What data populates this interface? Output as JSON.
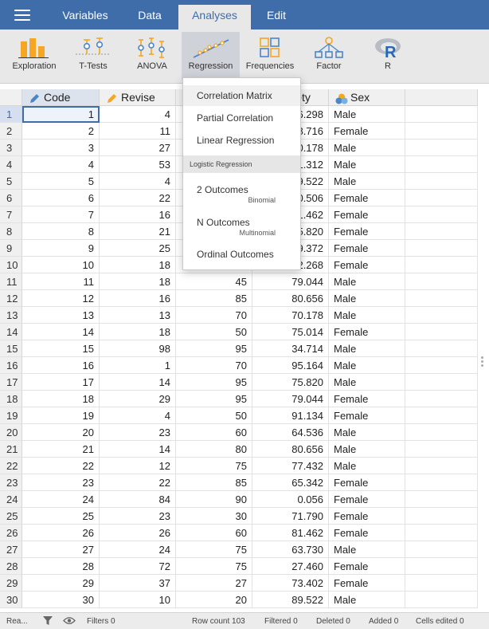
{
  "menubar": {
    "tabs": [
      {
        "label": "Variables"
      },
      {
        "label": "Data"
      },
      {
        "label": "Analyses"
      },
      {
        "label": "Edit"
      }
    ]
  },
  "ribbon": {
    "buttons": [
      {
        "label": "Exploration",
        "icon": "exploration-icon"
      },
      {
        "label": "T-Tests",
        "icon": "ttests-icon"
      },
      {
        "label": "ANOVA",
        "icon": "anova-icon"
      },
      {
        "label": "Regression",
        "icon": "regression-icon"
      },
      {
        "label": "Frequencies",
        "icon": "frequencies-icon"
      },
      {
        "label": "Factor",
        "icon": "factor-icon"
      },
      {
        "label": "R",
        "icon": "r-icon"
      }
    ]
  },
  "grid": {
    "columns": [
      {
        "name": "Code"
      },
      {
        "name": "Revise"
      },
      {
        "name": ""
      },
      {
        "name": "Anxiety"
      },
      {
        "name": "Sex"
      }
    ],
    "rows": [
      {
        "n": "1",
        "code": "1",
        "revise": "4",
        "exam": "",
        "anxiety": "86.298",
        "sex": "Male"
      },
      {
        "n": "2",
        "code": "2",
        "revise": "11",
        "exam": "",
        "anxiety": "88.716",
        "sex": "Female"
      },
      {
        "n": "3",
        "code": "3",
        "revise": "27",
        "exam": "",
        "anxiety": "70.178",
        "sex": "Male"
      },
      {
        "n": "4",
        "code": "4",
        "revise": "53",
        "exam": "",
        "anxiety": "61.312",
        "sex": "Male"
      },
      {
        "n": "5",
        "code": "5",
        "revise": "4",
        "exam": "",
        "anxiety": "89.522",
        "sex": "Male"
      },
      {
        "n": "6",
        "code": "6",
        "revise": "22",
        "exam": "",
        "anxiety": "60.506",
        "sex": "Female"
      },
      {
        "n": "7",
        "code": "7",
        "revise": "16",
        "exam": "",
        "anxiety": "81.462",
        "sex": "Female"
      },
      {
        "n": "8",
        "code": "8",
        "revise": "21",
        "exam": "",
        "anxiety": "75.820",
        "sex": "Female"
      },
      {
        "n": "9",
        "code": "9",
        "revise": "25",
        "exam": "",
        "anxiety": "69.372",
        "sex": "Female"
      },
      {
        "n": "10",
        "code": "10",
        "revise": "18",
        "exam": "",
        "anxiety": "82.268",
        "sex": "Female"
      },
      {
        "n": "11",
        "code": "11",
        "revise": "18",
        "exam": "45",
        "anxiety": "79.044",
        "sex": "Male"
      },
      {
        "n": "12",
        "code": "12",
        "revise": "16",
        "exam": "85",
        "anxiety": "80.656",
        "sex": "Male"
      },
      {
        "n": "13",
        "code": "13",
        "revise": "13",
        "exam": "70",
        "anxiety": "70.178",
        "sex": "Male"
      },
      {
        "n": "14",
        "code": "14",
        "revise": "18",
        "exam": "50",
        "anxiety": "75.014",
        "sex": "Female"
      },
      {
        "n": "15",
        "code": "15",
        "revise": "98",
        "exam": "95",
        "anxiety": "34.714",
        "sex": "Male"
      },
      {
        "n": "16",
        "code": "16",
        "revise": "1",
        "exam": "70",
        "anxiety": "95.164",
        "sex": "Male"
      },
      {
        "n": "17",
        "code": "17",
        "revise": "14",
        "exam": "95",
        "anxiety": "75.820",
        "sex": "Male"
      },
      {
        "n": "18",
        "code": "18",
        "revise": "29",
        "exam": "95",
        "anxiety": "79.044",
        "sex": "Female"
      },
      {
        "n": "19",
        "code": "19",
        "revise": "4",
        "exam": "50",
        "anxiety": "91.134",
        "sex": "Female"
      },
      {
        "n": "20",
        "code": "20",
        "revise": "23",
        "exam": "60",
        "anxiety": "64.536",
        "sex": "Male"
      },
      {
        "n": "21",
        "code": "21",
        "revise": "14",
        "exam": "80",
        "anxiety": "80.656",
        "sex": "Male"
      },
      {
        "n": "22",
        "code": "22",
        "revise": "12",
        "exam": "75",
        "anxiety": "77.432",
        "sex": "Male"
      },
      {
        "n": "23",
        "code": "23",
        "revise": "22",
        "exam": "85",
        "anxiety": "65.342",
        "sex": "Female"
      },
      {
        "n": "24",
        "code": "24",
        "revise": "84",
        "exam": "90",
        "anxiety": "0.056",
        "sex": "Female"
      },
      {
        "n": "25",
        "code": "25",
        "revise": "23",
        "exam": "30",
        "anxiety": "71.790",
        "sex": "Female"
      },
      {
        "n": "26",
        "code": "26",
        "revise": "26",
        "exam": "60",
        "anxiety": "81.462",
        "sex": "Female"
      },
      {
        "n": "27",
        "code": "27",
        "revise": "24",
        "exam": "75",
        "anxiety": "63.730",
        "sex": "Male"
      },
      {
        "n": "28",
        "code": "28",
        "revise": "72",
        "exam": "75",
        "anxiety": "27.460",
        "sex": "Female"
      },
      {
        "n": "29",
        "code": "29",
        "revise": "37",
        "exam": "27",
        "anxiety": "73.402",
        "sex": "Female"
      },
      {
        "n": "30",
        "code": "30",
        "revise": "10",
        "exam": "20",
        "anxiety": "89.522",
        "sex": "Male"
      }
    ]
  },
  "dropdown": {
    "items": [
      {
        "label": "Correlation Matrix"
      },
      {
        "label": "Partial Correlation"
      },
      {
        "label": "Linear Regression"
      }
    ],
    "section": "Logistic Regression",
    "logistic": [
      {
        "label": "2 Outcomes",
        "sub": "Binomial"
      },
      {
        "label": "N Outcomes",
        "sub": "Multinomial"
      },
      {
        "label": "Ordinal Outcomes",
        "sub": ""
      }
    ]
  },
  "status": {
    "ready": "Rea...",
    "filters": "Filters 0",
    "row_count": "Row count 103",
    "filtered": "Filtered 0",
    "deleted": "Deleted 0",
    "added": "Added 0",
    "cells_edited": "Cells edited 0"
  },
  "colors": {
    "brand": "#3e6da9",
    "ribbon": "#e8e8e8",
    "header": "#f0f0f0",
    "icon_orange": "#f5a623",
    "icon_blue": "#4a86c8"
  }
}
